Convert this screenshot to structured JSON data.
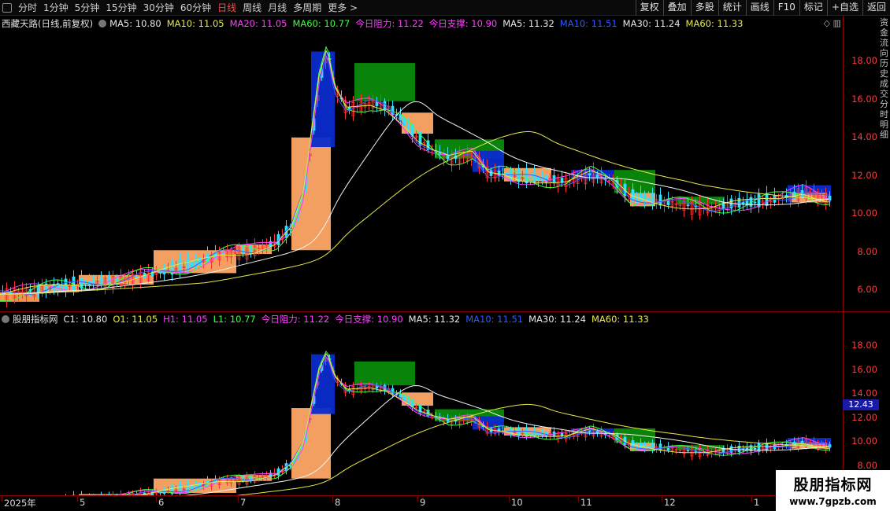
{
  "toolbar": {
    "periods": [
      "分时",
      "1分钟",
      "5分钟",
      "15分钟",
      "30分钟",
      "60分钟",
      "日线",
      "周线",
      "月线",
      "多周期",
      "更多 >"
    ],
    "active_index": 6,
    "right_buttons": [
      "复权",
      "叠加",
      "多股",
      "统计",
      "画线",
      "F10",
      "标记",
      "+自选",
      "返回"
    ]
  },
  "main_panel": {
    "title": "西藏天路(日线,前复权)",
    "legend": [
      {
        "text": "MA5: 10.80",
        "color": "#e8e8e8"
      },
      {
        "text": "MA10: 11.05",
        "color": "#e8e84a"
      },
      {
        "text": "MA20: 11.05",
        "color": "#ff40ff"
      },
      {
        "text": "MA60: 10.77",
        "color": "#40ff40"
      },
      {
        "text": "今日阻力: 11.22",
        "color": "#ff40ff"
      },
      {
        "text": "今日支撑: 10.90",
        "color": "#ff40ff"
      },
      {
        "text": "MA5: 11.32",
        "color": "#e8e8e8"
      },
      {
        "text": "MA10: 11.51",
        "color": "#2b5bff"
      },
      {
        "text": "MA30: 11.24",
        "color": "#e8e8e8"
      },
      {
        "text": "MA60: 11.33",
        "color": "#e8e84a"
      }
    ],
    "y_ticks": [
      "18.00",
      "16.00",
      "14.00",
      "12.00",
      "10.00",
      "8.00",
      "6.00"
    ]
  },
  "sub_panel": {
    "title": "股朋指标网",
    "legend": [
      {
        "text": "C1: 10.80",
        "color": "#e8e8e8"
      },
      {
        "text": "O1: 11.05",
        "color": "#e8e84a"
      },
      {
        "text": "H1: 11.05",
        "color": "#ff40ff"
      },
      {
        "text": "L1: 10.77",
        "color": "#40ff40"
      },
      {
        "text": "今日阻力: 11.22",
        "color": "#ff40ff"
      },
      {
        "text": "今日支撑: 10.90",
        "color": "#ff40ff"
      },
      {
        "text": "MA5: 11.32",
        "color": "#e8e8e8"
      },
      {
        "text": "MA10: 11.51",
        "color": "#2b5bff"
      },
      {
        "text": "MA30: 11.24",
        "color": "#e8e8e8"
      },
      {
        "text": "MA60: 11.33",
        "color": "#e8e84a"
      }
    ],
    "y_ticks": [
      "18.00",
      "16.00",
      "14.00",
      "12.00",
      "10.00",
      "8.00"
    ],
    "current_price": "12.43"
  },
  "date_axis": [
    "2025年",
    "5",
    "6",
    "7",
    "8",
    "9",
    "10",
    "11",
    "12",
    "1"
  ],
  "side_text": "资金流向历史成交分时明细",
  "watermark": {
    "line1": "股朋指标网",
    "line2": "www.7gpzb.com"
  },
  "icons": {
    "diamond": "diamond-icon",
    "panel": "panel-toggle-icon"
  }
}
